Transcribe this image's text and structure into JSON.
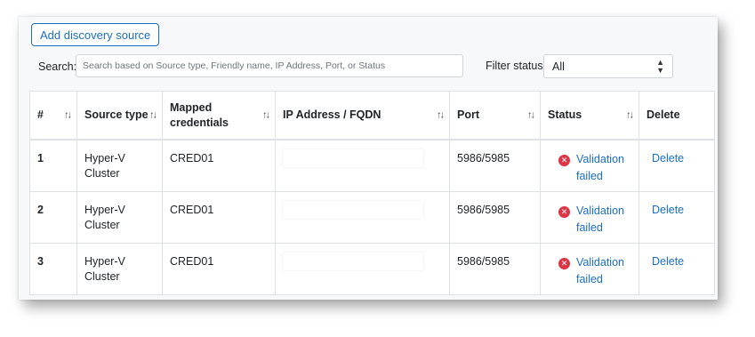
{
  "toolbar": {
    "add_label": "Add discovery source",
    "search_label": "Search:",
    "search_placeholder": "Search based on Source type, Friendly name, IP Address, Port, or Status",
    "search_value": "",
    "filter_label": "Filter status",
    "filter_value": "All"
  },
  "table": {
    "headers": [
      {
        "label": "#",
        "sortable": true
      },
      {
        "label": "Source type",
        "sortable": true
      },
      {
        "label": "Mapped credentials",
        "sortable": true
      },
      {
        "label": "IP Address / FQDN",
        "sortable": true
      },
      {
        "label": "Port",
        "sortable": true
      },
      {
        "label": "Status",
        "sortable": true
      },
      {
        "label": "Delete",
        "sortable": false
      }
    ],
    "rows": [
      {
        "num": "1",
        "source_type": "Hyper-V Cluster",
        "credentials": "CRED01",
        "ip": "",
        "port": "5986/5985",
        "status": "Validation failed",
        "delete": "Delete"
      },
      {
        "num": "2",
        "source_type": "Hyper-V Cluster",
        "credentials": "CRED01",
        "ip": "",
        "port": "5986/5985",
        "status": "Validation failed",
        "delete": "Delete"
      },
      {
        "num": "3",
        "source_type": "Hyper-V Cluster",
        "credentials": "CRED01",
        "ip": "",
        "port": "5986/5985",
        "status": "Validation failed",
        "delete": "Delete"
      }
    ]
  },
  "icons": {
    "sort": "sort-arrows-icon",
    "status_error": "error-circle-icon",
    "select_caret": "chevron-updown-icon"
  },
  "colors": {
    "link": "#1b6ec2",
    "error": "#dc3545",
    "border": "#dee2e6"
  }
}
